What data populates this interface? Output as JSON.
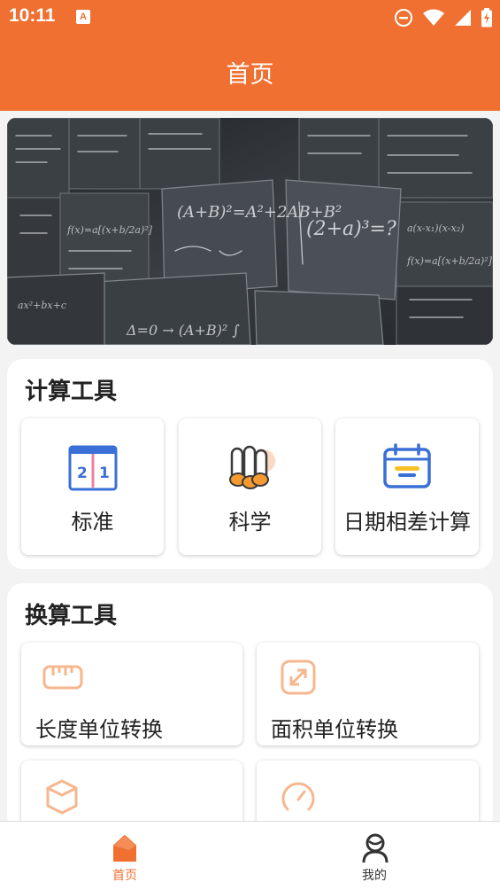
{
  "status_bar": {
    "time": "10:11",
    "notification_badge": "A",
    "icons": [
      "dnd-icon",
      "wifi-icon",
      "signal-icon",
      "battery-icon"
    ]
  },
  "app_bar": {
    "title": "首页"
  },
  "banner": {
    "image": "chalkboard-formulas-photo"
  },
  "calc_tools": {
    "title": "计算工具",
    "items": [
      {
        "label": "标准",
        "icon": "standard-calculator-icon"
      },
      {
        "label": "科学",
        "icon": "science-scrolls-icon"
      },
      {
        "label": "日期相差计算",
        "icon": "calendar-icon"
      }
    ]
  },
  "conv_tools": {
    "title": "换算工具",
    "items": [
      {
        "label": "长度单位转换",
        "icon": "ruler-icon"
      },
      {
        "label": "面积单位转换",
        "icon": "resize-arrows-icon"
      },
      {
        "label": "",
        "icon": "cube-icon"
      },
      {
        "label": "",
        "icon": "speedometer-icon"
      }
    ]
  },
  "bottom_nav": {
    "items": [
      {
        "label": "首页",
        "icon": "home-icon",
        "active": true
      },
      {
        "label": "我的",
        "icon": "person-icon",
        "active": false
      }
    ]
  },
  "colors": {
    "primary": "#ef7030",
    "icon_blue": "#3a6fd8",
    "icon_orange_light": "#f6b78f",
    "active_nav": "#ef7030",
    "inactive_nav": "#333333"
  }
}
